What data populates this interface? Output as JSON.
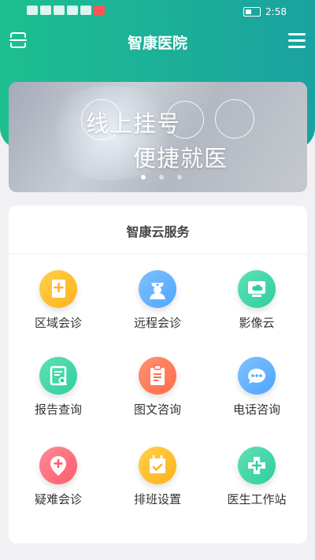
{
  "status_bar": {
    "time": "2:58"
  },
  "header": {
    "title": "智康医院"
  },
  "banner": {
    "line1": "线上挂号",
    "line2": "便捷就医",
    "active_dot": 0,
    "dot_count": 3
  },
  "services": {
    "title": "智康云服务",
    "items": [
      {
        "label": "区域会诊",
        "icon": "document-plus-icon",
        "color": "#ffb21d"
      },
      {
        "label": "远程会诊",
        "icon": "nurse-icon",
        "color": "#4fa6ff"
      },
      {
        "label": "影像云",
        "icon": "cloud-monitor-icon",
        "color": "#2fcf9e"
      },
      {
        "label": "报告查询",
        "icon": "report-search-icon",
        "color": "#2fcf9e"
      },
      {
        "label": "图文咨询",
        "icon": "clipboard-icon",
        "color": "#ff6b4a"
      },
      {
        "label": "电话咨询",
        "icon": "chat-bubble-icon",
        "color": "#4fa6ff"
      },
      {
        "label": "疑难会诊",
        "icon": "location-plus-icon",
        "color": "#ff5b6d"
      },
      {
        "label": "排班设置",
        "icon": "calendar-check-icon",
        "color": "#ffb21d"
      },
      {
        "label": "医生工作站",
        "icon": "medical-cross-icon",
        "color": "#2fcf9e"
      }
    ]
  }
}
